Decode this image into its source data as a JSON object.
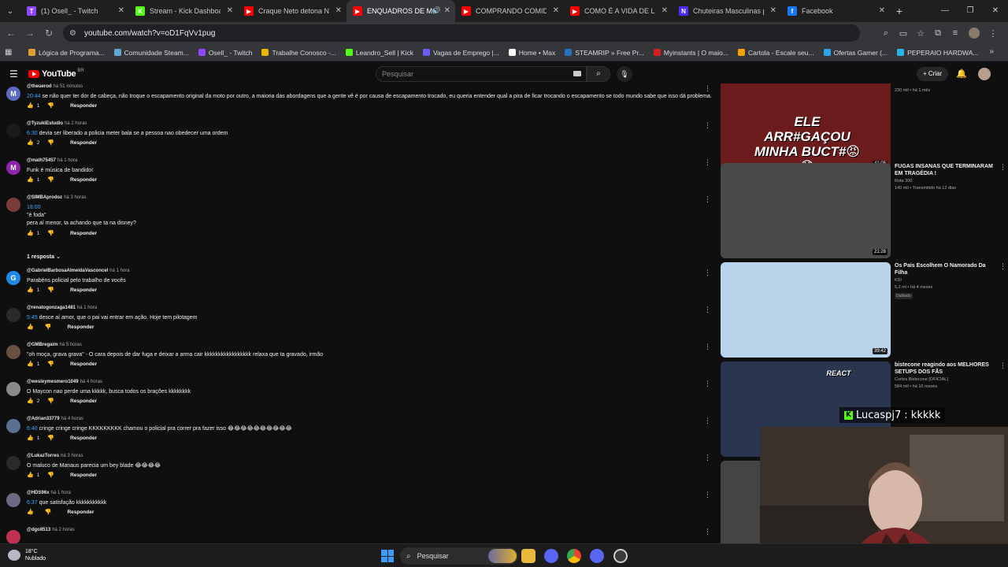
{
  "browser": {
    "tabs": [
      {
        "label": "(1) Osell_ - Twitch",
        "color": "#9146ff",
        "glyph": "T"
      },
      {
        "label": "Stream - Kick Dashboard",
        "color": "#53fc18",
        "glyph": "K"
      },
      {
        "label": "Craque Neto detona Ney",
        "color": "#ff0000",
        "glyph": "▶"
      },
      {
        "label": "ENQUADROS DE MOT",
        "color": "#ff0000",
        "glyph": "▶",
        "active": true
      },
      {
        "label": "COMPRANDO COMIDAS",
        "color": "#ff0000",
        "glyph": "▶"
      },
      {
        "label": "COMO É A VIDA DE LUXO",
        "color": "#ff0000",
        "glyph": "▶"
      },
      {
        "label": "Chuteiras Masculinas par",
        "color": "#4f2cff",
        "glyph": "N"
      },
      {
        "label": "Facebook",
        "color": "#1877f2",
        "glyph": "f"
      }
    ],
    "url": "youtube.com/watch?v=oD1FqVv1pug",
    "bookmarks": [
      {
        "label": "Lógica de Programa...",
        "color": "#e0a030"
      },
      {
        "label": "Comunidade Steam...",
        "color": "#5fa8d3"
      },
      {
        "label": "Osell_ - Twitch",
        "color": "#9146ff"
      },
      {
        "label": "Trabalhe Conosco -...",
        "color": "#e8b800"
      },
      {
        "label": "Leandro_Sell | Kick",
        "color": "#53fc18"
      },
      {
        "label": "Vagas de Emprego |...",
        "color": "#6b5cff"
      },
      {
        "label": "Home • Max",
        "color": "#ffffff"
      },
      {
        "label": "STEAMRIP » Free Pr...",
        "color": "#2a6fc4"
      },
      {
        "label": "Myinstants | O maio...",
        "color": "#d62020"
      },
      {
        "label": "Cartola - Escale seu...",
        "color": "#f5a000"
      },
      {
        "label": "Ofertas Gamer (...",
        "color": "#2aa3e8"
      },
      {
        "label": "PEPERAIO HARDWA...",
        "color": "#2ab3e8"
      }
    ]
  },
  "youtube": {
    "logo_text": "YouTube",
    "logo_region": "BR",
    "search_placeholder": "Pesquisar",
    "create_label": "Criar"
  },
  "comments": [
    {
      "user": "@theuerod",
      "ago": "há 51 minutos",
      "ts": "20:44",
      "text": "se não quer ter dor de cabeça, não troque o escapamento original da moto por outro, a maioria das abordagens que a gente vê é por causa de escapamento trocado, eu queria entender qual a pira de ficar trocando o escapamento se todo mundo sabe que isso dá problema.",
      "likes": "1",
      "reply": "Responder",
      "avatar": "M",
      "avcolor": "#5c6bc0"
    },
    {
      "user": "@TyzukiEstudio",
      "ago": "há 2 horas",
      "ts": "6:30",
      "text": "devia ser liberado a policia meter bala se a pessoa nao obedecer uma ordem",
      "likes": "2",
      "reply": "Responder",
      "avatar": "",
      "avcolor": "#1a1a1a"
    },
    {
      "user": "@math75457",
      "ago": "há 1 hora",
      "ts": "",
      "text": "Funk é música de bandido!",
      "likes": "1",
      "reply": "Responder",
      "avatar": "M",
      "avcolor": "#8e24aa"
    },
    {
      "user": "@SIMBAprodoz",
      "ago": "há 3 horas",
      "ts": "18:00",
      "text": "\"é foda\"",
      "text2": "pera aí menor, ta achando que ta na disney?",
      "likes": "1",
      "reply": "Responder",
      "avatar": "",
      "avcolor": "#7a3b3b"
    },
    {
      "user": "@GabrielBarbosaAlmeidaVasconcel",
      "ago": "há 1 hora",
      "ts": "",
      "text": "Parabéns policial pelo trabalho de vocês",
      "likes": "1",
      "reply": "Responder",
      "avatar": "G",
      "avcolor": "#1e88e5"
    },
    {
      "user": "@renatogonzaga1481",
      "ago": "há 1 hora",
      "ts": "5:45",
      "text": "desce aí amor, que o pai vai entrar em ação. Hoje tem pilotagem",
      "likes": "",
      "reply": "Responder",
      "avatar": "",
      "avcolor": "#2a2a2a"
    },
    {
      "user": "@GMBregaim",
      "ago": "há 5 horas",
      "ts": "",
      "text": "\"oh moça, grava grava\" - O cara depois de dar fuga e deixar a arma cair kkkkkkkkkkkkkkkkk relaxa que ta gravado, irmão",
      "likes": "1",
      "reply": "Responder",
      "avatar": "",
      "avcolor": "#6a5040"
    },
    {
      "user": "@wesleymesmero1049",
      "ago": "há 4 horas",
      "ts": "",
      "text": "O Maycon nao perde uma kkkkk, busca todos os brações kkkkkkkk",
      "likes": "2",
      "reply": "Responder",
      "avatar": "",
      "avcolor": "#8a8a8a"
    },
    {
      "user": "@Adrian33779",
      "ago": "há 4 horas",
      "ts": "6:40",
      "text": "cringe cringe cringe KKKKKKKKK chamou o policial pra correr pra fazer isso 😂😂😂😂😂😂😂😂😂😂",
      "likes": "1",
      "reply": "Responder",
      "avatar": "",
      "avcolor": "#5a7090"
    },
    {
      "user": "@LukazTorres",
      "ago": "há 3 horas",
      "ts": "",
      "text": "O maluco de Manaus parecia um bey blade 😂😂😂😂",
      "likes": "1",
      "reply": "Responder",
      "avatar": "",
      "avcolor": "#2a2a2a"
    },
    {
      "user": "@HDS96x",
      "ago": "há 1 hora",
      "ts": "6:37",
      "text": "que satisfação kkkkkkkkkkk",
      "likes": "",
      "reply": "Responder",
      "avatar": "",
      "avcolor": "#6a6a80"
    },
    {
      "user": "@dgo8513",
      "ago": "há 2 horas",
      "ts": "",
      "text": "",
      "likes": "",
      "reply": "",
      "avatar": "",
      "avcolor": "#c03050"
    }
  ],
  "replies_toggle": "1 resposta",
  "recommendations": [
    {
      "title": "",
      "channel": "",
      "stats": "230 mil • há 1 mês",
      "duration": "41:05",
      "thumb_text": "ELE ARR#GAÇOU MINHA BUCT#😡😱",
      "bg": "#6b1b1b"
    },
    {
      "title": "FUGAS INSANAS QUE TERMINARAM EM TRAGÉDIA !",
      "channel": "Rota 300",
      "stats": "140 mil • Transmitido há 12 dias",
      "duration": "21:28",
      "thumb_text": "",
      "bg": "#4a4a4a"
    },
    {
      "title": "Os Pais Escolhem O Namorado Da Filha",
      "channel": "KSI",
      "stats": "5,2 mi • há 4 meses",
      "duration": "39:42",
      "badge": "Dublado",
      "thumb_text": "",
      "bg": "#b9d4ea"
    },
    {
      "title": "bistecone reagindo aos MELHORES SETUPS DOS FÃS",
      "channel": "Cortes Bistecone [OFICIAL]",
      "stats": "584 mil • há 10 meses",
      "duration": "",
      "thumb_text": "REACT",
      "bg": "#2a3550"
    },
    {
      "title": "",
      "channel": "",
      "stats": "",
      "duration": "",
      "thumb_text": "",
      "bg": "#444"
    }
  ],
  "overlay": {
    "chat_user": "Lucaspj7",
    "chat_msg": ": kkkkk"
  },
  "taskbar": {
    "temp": "18°C",
    "weather": "Nublado",
    "search": "Pesquisar"
  }
}
